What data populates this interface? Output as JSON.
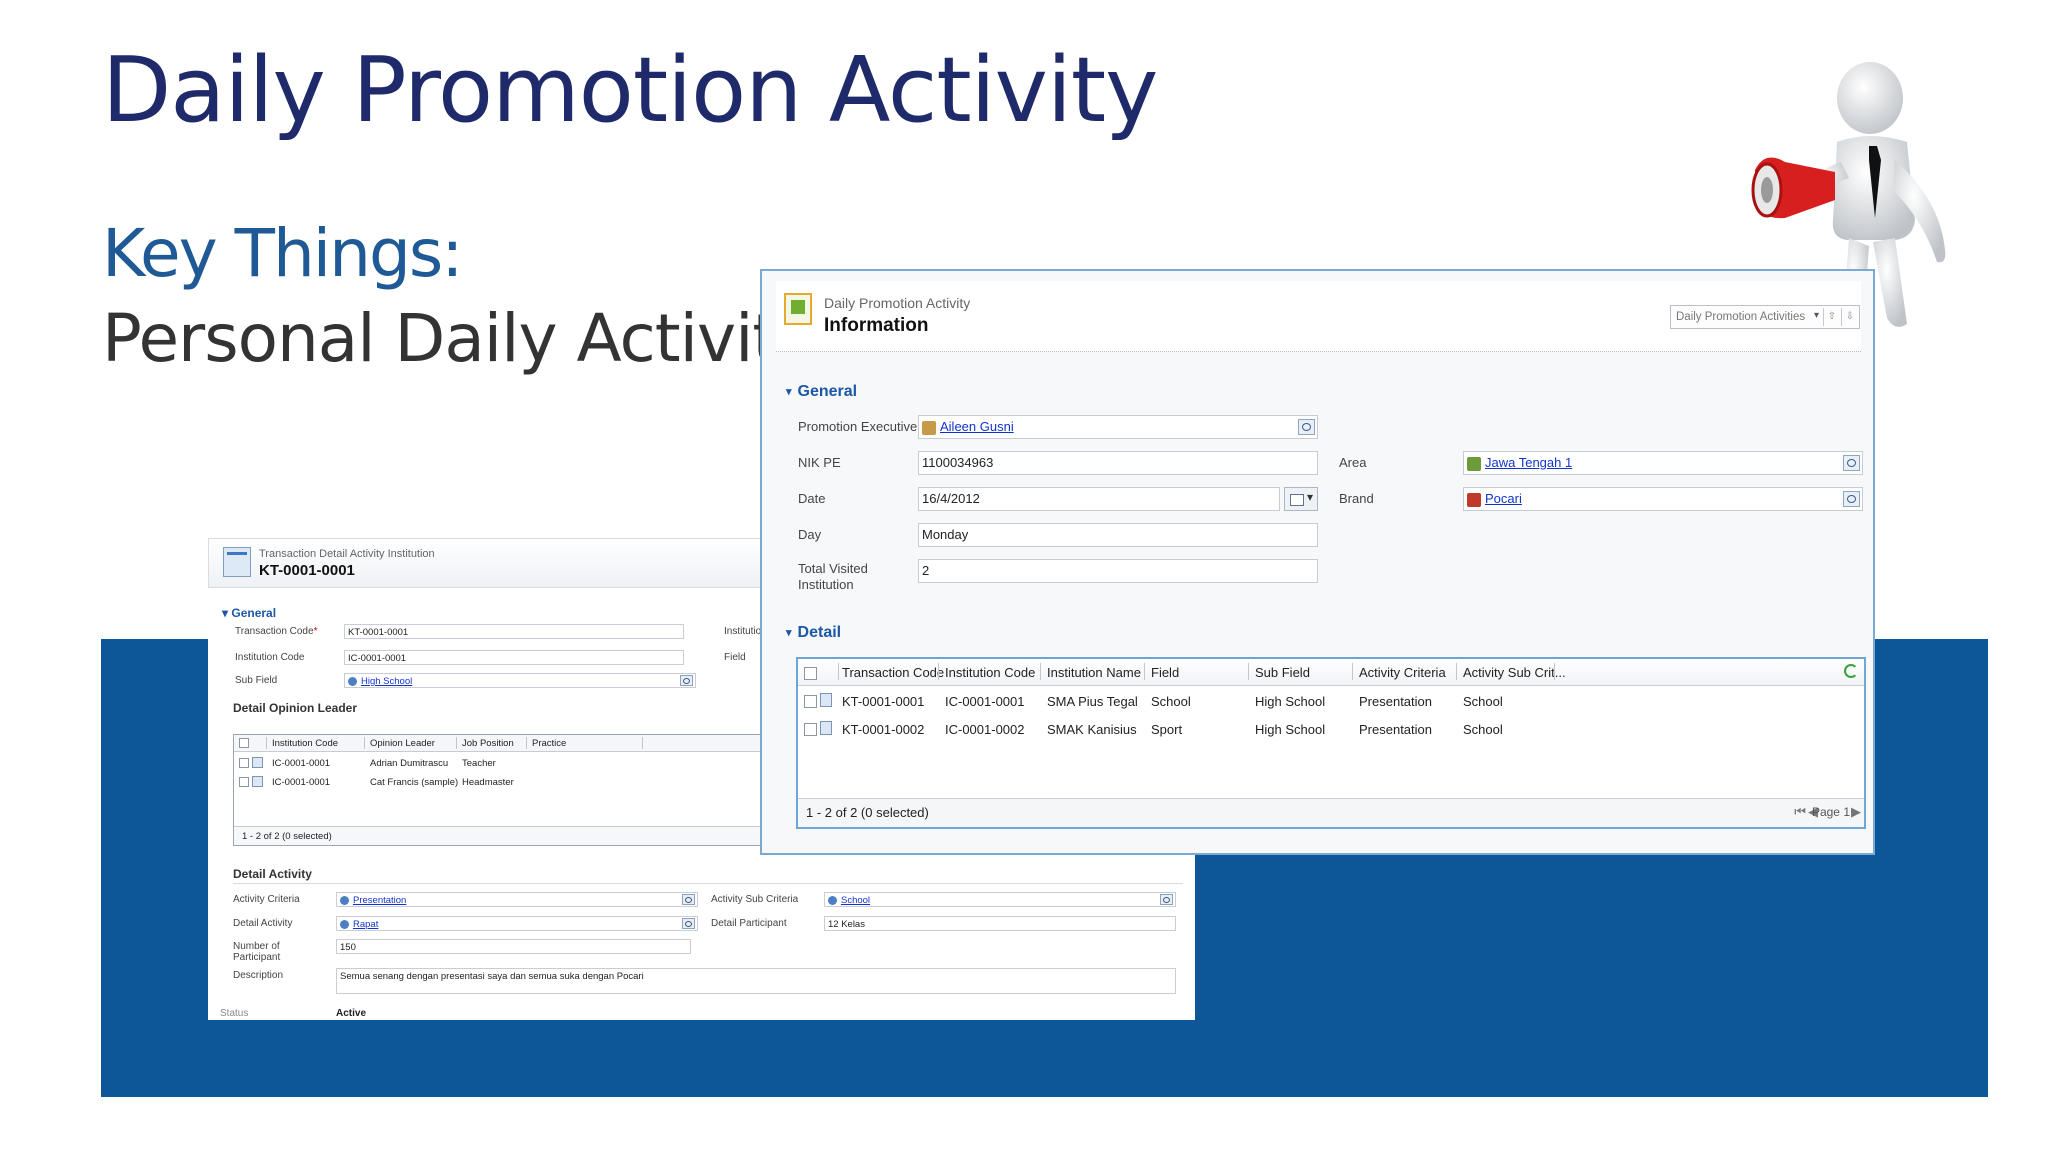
{
  "slide": {
    "title": "Daily Promotion Activity",
    "key_title": "Key Things:",
    "key_subtitle": "Personal Daily Activity"
  },
  "back_form": {
    "header_sub": "Transaction Detail Activity Institution",
    "header_title": "KT-0001-0001",
    "general_label": "General",
    "fields": {
      "transaction_code_label": "Transaction Code",
      "required_mark": "*",
      "transaction_code_value": "KT-0001-0001",
      "institution_code_label": "Institution Code",
      "institution_code_value": "IC-0001-0001",
      "sub_field_label": "Sub Field",
      "sub_field_value": "High School",
      "institution_label_right": "Institution",
      "field_label_right": "Field"
    },
    "opinion_leader_section": "Detail Opinion Leader",
    "opinion_grid": {
      "headers": [
        "Institution Code",
        "Opinion Leader",
        "Job Position",
        "Practice"
      ],
      "rows": [
        [
          "IC-0001-0001",
          "Adrian Dumitrascu",
          "Teacher",
          ""
        ],
        [
          "IC-0001-0001",
          "Cat Francis (sample)",
          "Headmaster",
          ""
        ]
      ],
      "footer": "1 - 2 of 2 (0 selected)"
    },
    "detail_activity_section": "Detail Activity",
    "activity": {
      "criteria_label": "Activity Criteria",
      "criteria_value": "Presentation",
      "sub_criteria_label": "Activity Sub Criteria",
      "sub_criteria_value": "School",
      "detail_activity_label": "Detail Activity",
      "detail_activity_value": "Rapat",
      "detail_participant_label": "Detail Participant",
      "detail_participant_value": "12 Kelas",
      "participants_label_1": "Number of",
      "participants_label_2": "Participant",
      "participants_value": "150",
      "description_label": "Description",
      "description_value": "Semua senang dengan presentasi saya dan semua suka dengan Pocari",
      "status_label": "Status",
      "status_value": "Active"
    }
  },
  "front_form": {
    "header_sub": "Daily Promotion Activity",
    "header_title": "Information",
    "nav_label": "Daily Promotion Activities",
    "general_label": "General",
    "fields": {
      "promotion_executive_label": "Promotion Executive",
      "promotion_executive_value": "Aileen Gusni",
      "nik_label": "NIK PE",
      "nik_value": "1100034963",
      "date_label": "Date",
      "date_value": "16/4/2012",
      "day_label": "Day",
      "day_value": "Monday",
      "total_visited_label_1": "Total Visited",
      "total_visited_label_2": "Institution",
      "total_visited_value": "2",
      "area_label": "Area",
      "area_value": "Jawa Tengah 1",
      "brand_label": "Brand",
      "brand_value": "Pocari"
    },
    "detail_label": "Detail",
    "detail_grid": {
      "headers": [
        "Transaction Code",
        "Institution Code",
        "Institution Name",
        "Field",
        "Sub Field",
        "Activity Criteria",
        "Activity Sub Crit..."
      ],
      "rows": [
        [
          "KT-0001-0001",
          "IC-0001-0001",
          "SMA Pius Tegal",
          "School",
          "High School",
          "Presentation",
          "School"
        ],
        [
          "KT-0001-0002",
          "IC-0001-0002",
          "SMAK Kanisius",
          "Sport",
          "High School",
          "Presentation",
          "School"
        ]
      ],
      "footer": "1 - 2 of 2 (0 selected)",
      "page_label": "Page 1"
    }
  },
  "colors": {
    "title": "#1f2a6b",
    "key_title": "#1f5a96",
    "band": "#0d5799",
    "section": "#1d58a6",
    "link": "#1234cc"
  },
  "icons": [
    "mascot-megaphone-figure",
    "record-icon",
    "lookup-icon",
    "calendar-icon",
    "refresh-icon",
    "page-first-icon",
    "page-prev-icon",
    "page-next-icon"
  ]
}
